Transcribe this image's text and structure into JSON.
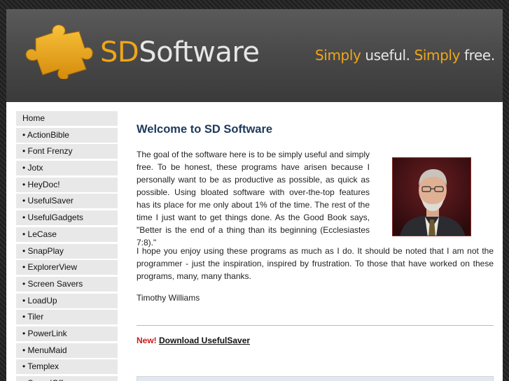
{
  "header": {
    "logo_sd": "SD",
    "logo_software": "Software",
    "tagline": [
      {
        "text": "Simply ",
        "accent": true
      },
      {
        "text": "useful. ",
        "accent": false
      },
      {
        "text": "Simply ",
        "accent": true
      },
      {
        "text": "free.",
        "accent": false
      }
    ]
  },
  "colors": {
    "accent": "#f0a616",
    "title": "#1c3a5c",
    "new_label": "#cc1a1a",
    "nav_bg": "#e8e8e8"
  },
  "sidebar": {
    "items": [
      {
        "label": "Home"
      },
      {
        "label": "• ActionBible"
      },
      {
        "label": "• Font Frenzy"
      },
      {
        "label": "• Jotx"
      },
      {
        "label": "• HeyDoc!"
      },
      {
        "label": "• UsefulSaver"
      },
      {
        "label": "• UsefulGadgets"
      },
      {
        "label": "• LeCase"
      },
      {
        "label": "• SnapPlay"
      },
      {
        "label": "• ExplorerView"
      },
      {
        "label": "• Screen Savers"
      },
      {
        "label": "• LoadUp"
      },
      {
        "label": "• Tiler"
      },
      {
        "label": "• PowerLink"
      },
      {
        "label": "• MenuMaid"
      },
      {
        "label": "• Templex"
      },
      {
        "label": "• SpeedOff"
      }
    ]
  },
  "main": {
    "title": "Welcome to SD Software",
    "paragraph1": "The goal of the software here is to be simply useful and simply free. To be honest, these programs have arisen because I personally want to be as productive as possible, as quick as possible. Using bloated software with over-the-top features has its place for me only about 1% of the time. The rest of the time I just want to get things done. As the Good Book says, \"Better is the end of a thing than its beginning (Ecclesiastes 7:8).\"",
    "paragraph2": "I hope you enjoy using these programs as much as I do. It should be noted that I am not the programmer - just the inspiration, inspired by frustration. To those that have worked on these programs, many, many thanks.",
    "signature": "Timothy Williams",
    "new_label": "New!",
    "download_link": "Download UsefulSaver",
    "photo_icon": "portrait-photo"
  }
}
